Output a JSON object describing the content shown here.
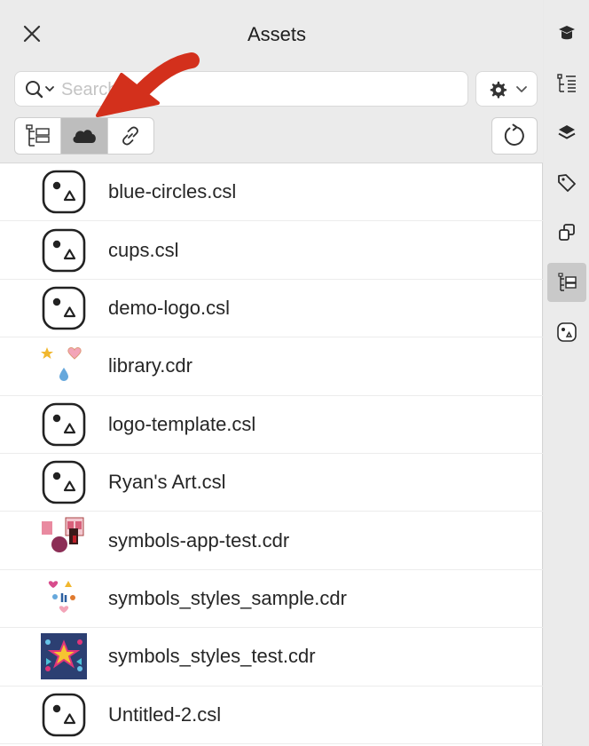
{
  "panel": {
    "title": "Assets",
    "close_icon": "close-icon"
  },
  "search": {
    "placeholder": "Search",
    "value": ""
  },
  "toolbar": {
    "settings_icon": "gear-icon",
    "view_buttons": [
      {
        "name": "hierarchy",
        "icon": "hierarchy-icon",
        "active": false
      },
      {
        "name": "cloud",
        "icon": "cloud-icon",
        "active": true
      },
      {
        "name": "link",
        "icon": "link-icon",
        "active": false
      }
    ],
    "refresh_icon": "refresh-icon"
  },
  "assets": [
    {
      "name": "blue-circles.csl",
      "thumb": "symbol-library-icon"
    },
    {
      "name": "cups.csl",
      "thumb": "symbol-library-icon"
    },
    {
      "name": "demo-logo.csl",
      "thumb": "symbol-library-icon"
    },
    {
      "name": "library.cdr",
      "thumb": "library-preview"
    },
    {
      "name": "logo-template.csl",
      "thumb": "symbol-library-icon"
    },
    {
      "name": "Ryan's Art.csl",
      "thumb": "symbol-library-icon"
    },
    {
      "name": "symbols-app-test.cdr",
      "thumb": "symbols-app-preview"
    },
    {
      "name": "symbols_styles_sample.cdr",
      "thumb": "symbols-sample-preview"
    },
    {
      "name": "symbols_styles_test.cdr",
      "thumb": "symbols-test-preview"
    },
    {
      "name": "Untitled-2.csl",
      "thumb": "symbol-library-icon"
    }
  ],
  "rail": [
    {
      "name": "learn",
      "icon": "hat-icon",
      "active": false
    },
    {
      "name": "properties",
      "icon": "properties-icon",
      "active": false
    },
    {
      "name": "layers",
      "icon": "layers-icon",
      "active": false
    },
    {
      "name": "tags",
      "icon": "tag-icon",
      "active": false
    },
    {
      "name": "symbols",
      "icon": "symbols-icon",
      "active": false
    },
    {
      "name": "hierarchy",
      "icon": "hierarchy-icon",
      "active": true
    },
    {
      "name": "assets",
      "icon": "assets-icon",
      "active": false
    }
  ],
  "colors": {
    "header_bg": "#ebebeb",
    "active_segment": "#bdbdbd",
    "annotation_arrow": "#d3301c"
  }
}
